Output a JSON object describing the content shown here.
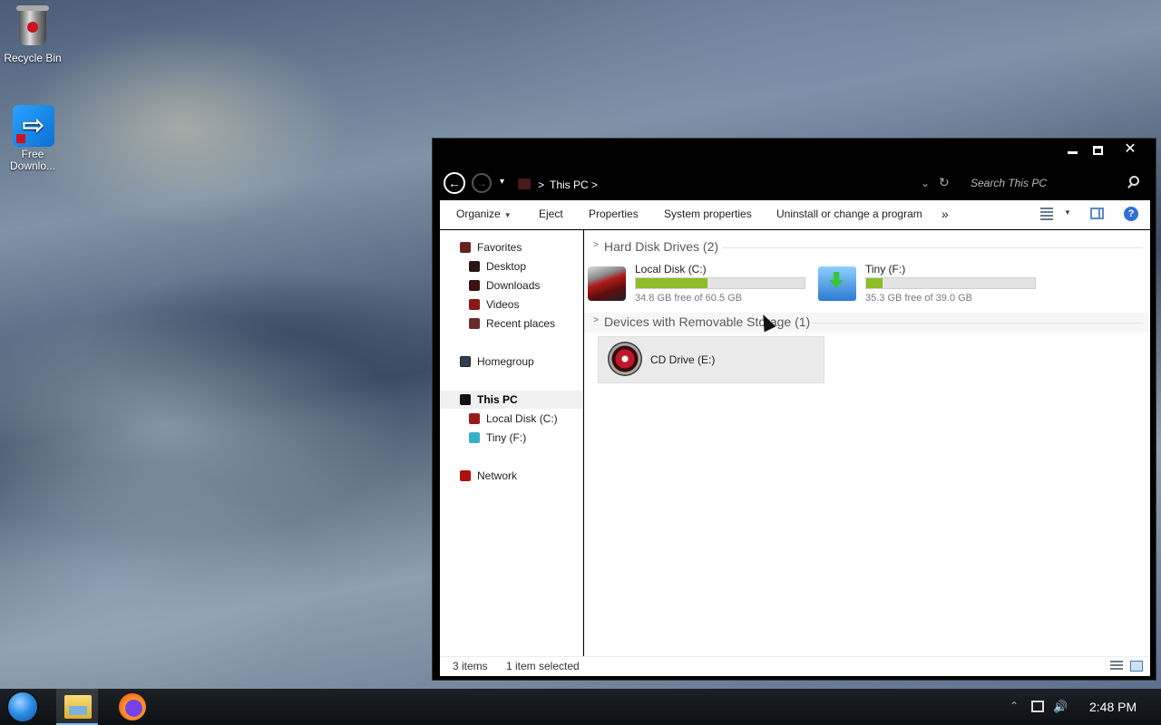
{
  "desktop": {
    "icons": [
      {
        "label": "Recycle Bin",
        "icon": "recycle-bin-icon"
      },
      {
        "label": "Free Downlo...",
        "icon": "free-download-manager-icon"
      }
    ]
  },
  "window": {
    "titlebar": {
      "minimize_glyph": "",
      "maximize_glyph": "",
      "close_glyph": "✕"
    },
    "nav": {
      "back_glyph": "←",
      "forward_glyph": "→",
      "recent_glyph": "▾",
      "breadcrumb_sep": ">",
      "breadcrumb": [
        "This PC"
      ],
      "address_dropdown_glyph": "⌄",
      "refresh_glyph": "↻",
      "search_placeholder": "Search This PC"
    },
    "toolbar": {
      "organize": "Organize",
      "organize_caret": "▼",
      "eject": "Eject",
      "properties": "Properties",
      "system_properties": "System properties",
      "uninstall": "Uninstall or change a program",
      "more_glyph": "»",
      "view_caret": "▼",
      "help_glyph": "?"
    },
    "navpane": {
      "favorites": "Favorites",
      "desktop": "Desktop",
      "downloads": "Downloads",
      "videos": "Videos",
      "recent_places": "Recent places",
      "homegroup": "Homegroup",
      "this_pc": "This PC",
      "local_disk": "Local Disk (C:)",
      "tiny": "Tiny (F:)",
      "network": "Network"
    },
    "content": {
      "groups": [
        {
          "title": "Hard Disk Drives (2)",
          "chevron": ">",
          "drives": [
            {
              "name": "Local Disk (C:)",
              "free_text": "34.8 GB free of 60.5 GB",
              "used_fraction": 0.425,
              "icon": "hard-disk-icon"
            },
            {
              "name": "Tiny (F:)",
              "free_text": "35.3 GB free of 39.0 GB",
              "used_fraction": 0.095,
              "icon": "usb-drive-icon"
            }
          ]
        },
        {
          "title": "Devices with Removable Storage (1)",
          "chevron": ">",
          "drives": [
            {
              "name": "CD Drive (E:)",
              "icon": "cd-drive-icon"
            }
          ]
        }
      ]
    },
    "status": {
      "items": "3 items",
      "selected": "1 item selected"
    }
  },
  "taskbar": {
    "apps": [
      "start-orb-icon",
      "file-explorer-icon",
      "firefox-icon"
    ],
    "tray": {
      "up_glyph": "⌃",
      "volume_glyph": "🔊"
    },
    "clock": "2:48 PM"
  },
  "colors": {
    "capacity_fill": "#8ebd27",
    "window_frame": "#000000",
    "selected_row": "#f0f0f0"
  }
}
